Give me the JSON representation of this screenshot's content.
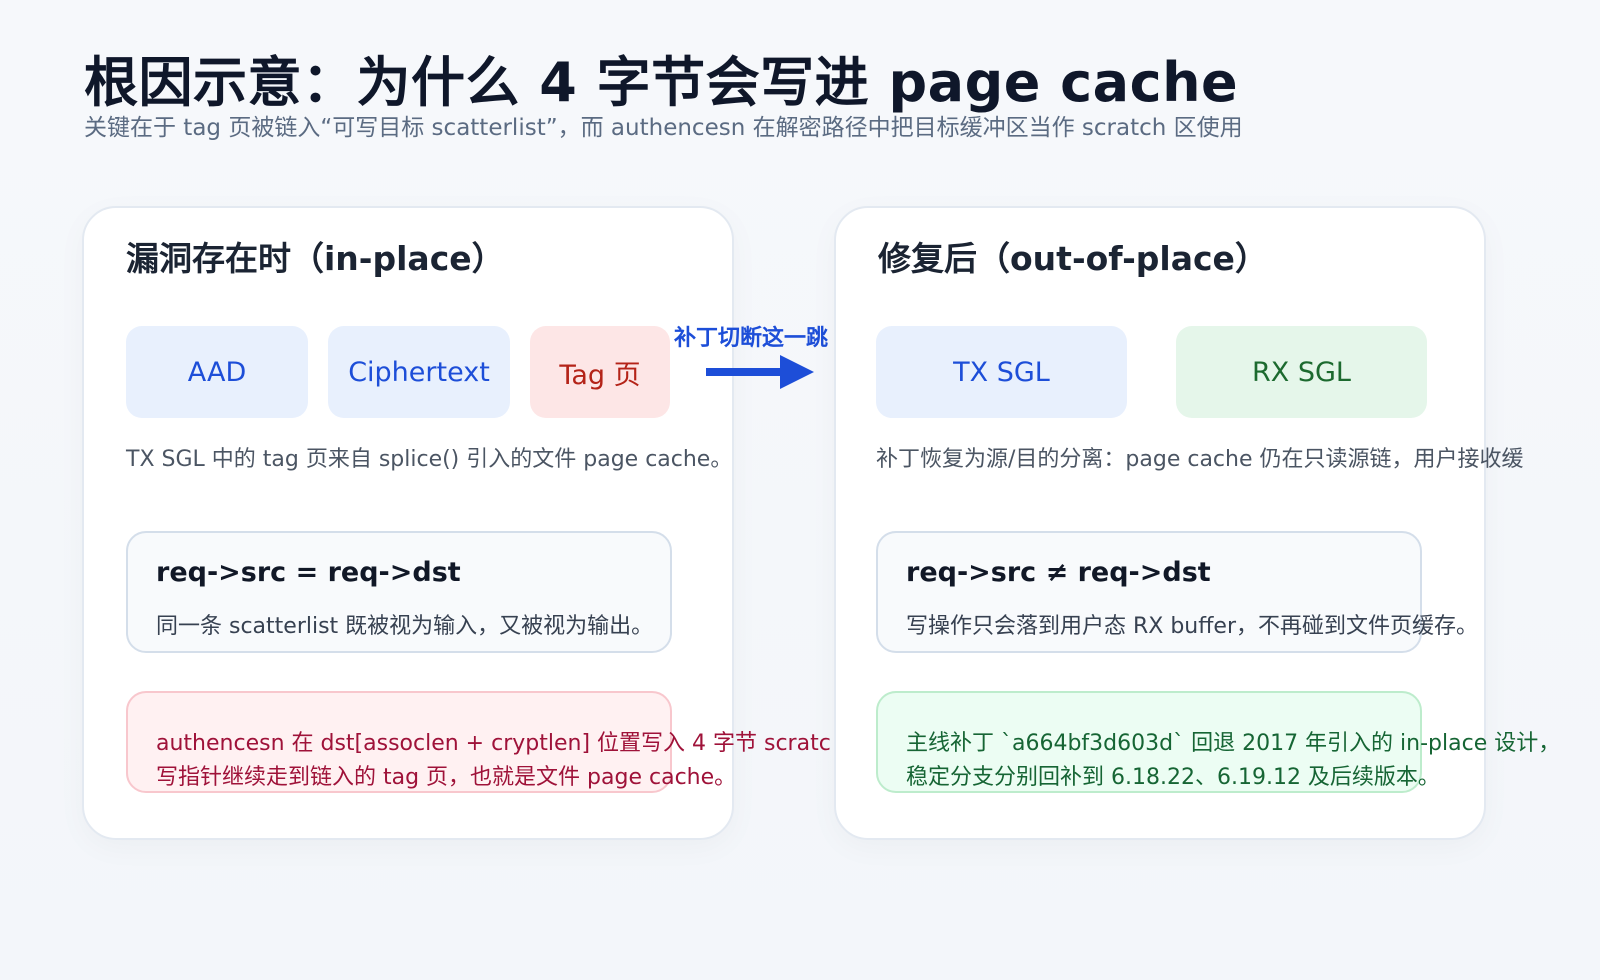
{
  "header": {
    "title": "根因示意：为什么 4 字节会写进 page cache",
    "subtitle": "关键在于 tag 页被链入“可写目标 scatterlist”，而 authencesn 在解密路径中把目标缓冲区当作 scratch 区使用"
  },
  "left": {
    "title": "漏洞存在时（in-place）",
    "chips": [
      "AAD",
      "Ciphertext",
      "Tag 页"
    ],
    "caption": "TX SGL 中的 tag 页来自 splice() 引入的文件 page cache。",
    "formula": "req->src = req->dst",
    "formula_note": "同一条 scatterlist 既被视为输入，又被视为输出。",
    "note_lines": [
      "authencesn 在 dst[assoclen + cryptlen] 位置写入 4 字节 scratc",
      "写指针继续走到链入的 tag 页，也就是文件 page cache。"
    ]
  },
  "bridge": {
    "label": "补丁切断这一跳"
  },
  "right": {
    "title": "修复后（out-of-place）",
    "chips": [
      "TX SGL",
      "RX SGL"
    ],
    "caption": "补丁恢复为源/目的分离：page cache 仍在只读源链，用户接收缓",
    "formula": "req->src ≠ req->dst",
    "formula_note": "写操作只会落到用户态 RX buffer，不再碰到文件页缓存。",
    "note_lines": [
      "主线补丁 `a664bf3d603d` 回退 2017 年引入的 in-place 设计，",
      "稳定分支分别回补到 6.18.22、6.19.12 及后续版本。"
    ]
  },
  "colors": {
    "accent_blue": "#1d4ed8",
    "warning_red": "#b42318",
    "success_green": "#166534"
  }
}
